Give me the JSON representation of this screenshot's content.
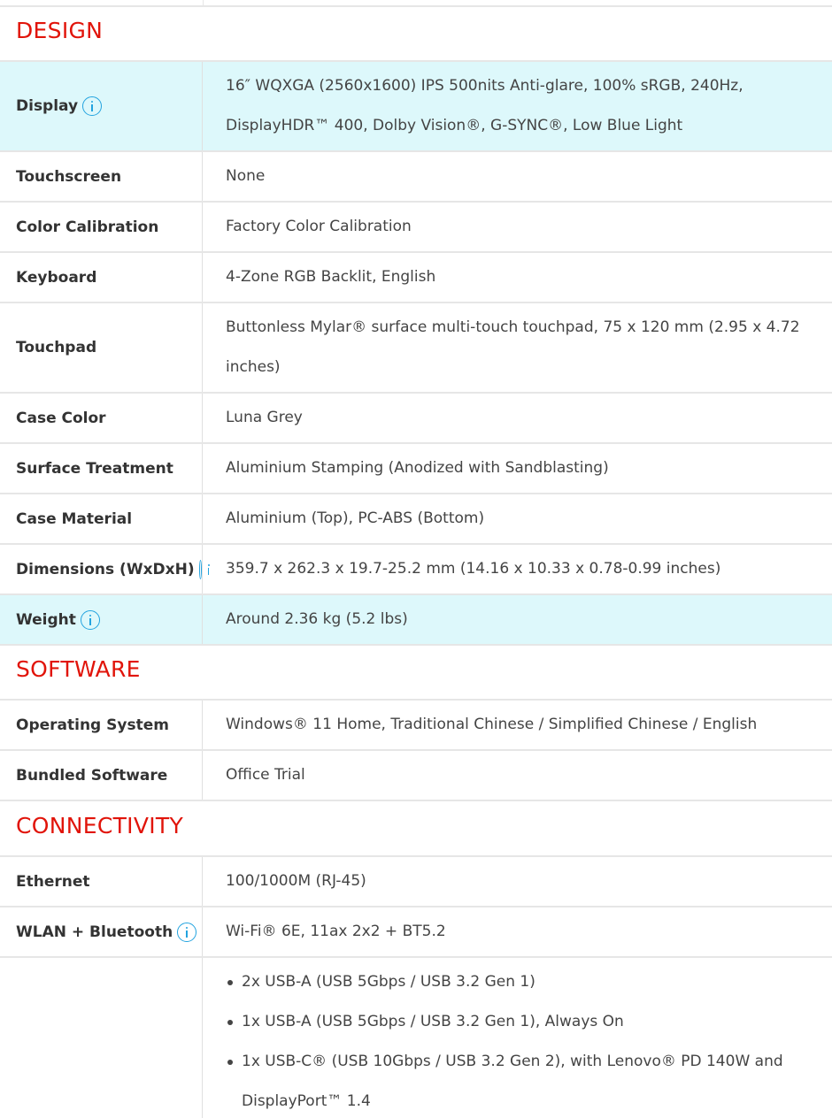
{
  "sections": {
    "design": {
      "title": "DESIGN",
      "rows": [
        {
          "label": "Display",
          "value": "16″ WQXGA (2560x1600) IPS 500nits Anti-glare, 100% sRGB, 240Hz, DisplayHDR™ 400, Dolby Vision®, G-SYNC®, Low Blue Light"
        },
        {
          "label": "Touchscreen",
          "value": "None"
        },
        {
          "label": "Color Calibration",
          "value": "Factory Color Calibration"
        },
        {
          "label": "Keyboard",
          "value": "4-Zone RGB Backlit, English"
        },
        {
          "label": "Touchpad",
          "value": "Buttonless Mylar® surface multi-touch touchpad, 75 x 120 mm (2.95 x 4.72 inches)"
        },
        {
          "label": "Case Color",
          "value": "Luna Grey"
        },
        {
          "label": "Surface Treatment",
          "value": "Aluminium Stamping (Anodized with Sandblasting)"
        },
        {
          "label": "Case Material",
          "value": "Aluminium (Top), PC-ABS (Bottom)"
        },
        {
          "label": "Dimensions (WxDxH)",
          "value": "359.7 x 262.3 x 19.7-25.2 mm (14.16 x 10.33 x 0.78-0.99 inches)"
        },
        {
          "label": "Weight",
          "value": "Around 2.36 kg (5.2 lbs)"
        }
      ]
    },
    "software": {
      "title": "SOFTWARE",
      "rows": [
        {
          "label": "Operating System",
          "value": "Windows® 11 Home, Traditional Chinese / Simplified Chinese / English"
        },
        {
          "label": "Bundled Software",
          "value": "Office Trial"
        }
      ]
    },
    "connectivity": {
      "title": "CONNECTIVITY",
      "rows": [
        {
          "label": "Ethernet",
          "value": "100/1000M (RJ-45)"
        },
        {
          "label": "WLAN + Bluetooth",
          "value": "Wi-Fi® 6E, 11ax 2x2 + BT5.2"
        }
      ],
      "ports": [
        "2x USB-A (USB 5Gbps / USB 3.2 Gen 1)",
        "1x USB-A (USB 5Gbps / USB 3.2 Gen 1), Always On",
        "1x USB-C® (USB 10Gbps / USB 3.2 Gen 2), with Lenovo® PD 140W and DisplayPort™ 1.4"
      ]
    }
  },
  "colors": {
    "section_title": "#e1140a",
    "highlight_row": "#ddf8fb",
    "info_icon": "#22a3df",
    "border": "#e6e6e6"
  }
}
